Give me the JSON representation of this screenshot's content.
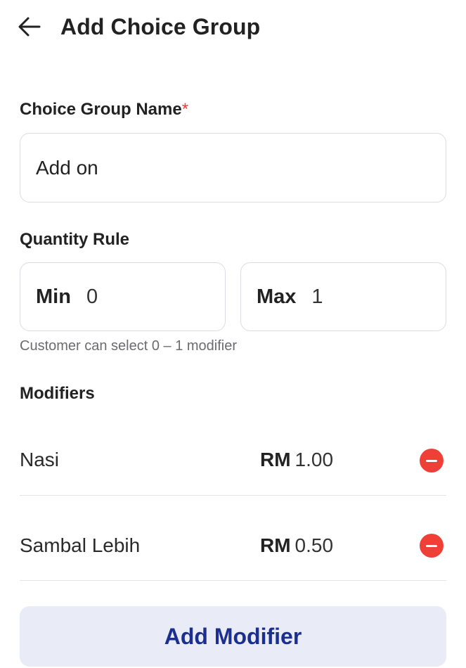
{
  "header": {
    "title": "Add Choice Group",
    "back_icon": "arrow-left-icon"
  },
  "name_field": {
    "label": "Choice Group Name",
    "required_mark": "*",
    "value": "Add on"
  },
  "quantity_rule": {
    "label": "Quantity Rule",
    "min_label": "Min",
    "min_value": "0",
    "max_label": "Max",
    "max_value": "1",
    "helper": "Customer can select 0 – 1 modifier"
  },
  "modifiers": {
    "label": "Modifiers",
    "items": [
      {
        "name": "Nasi",
        "currency": "RM",
        "price": "1.00"
      },
      {
        "name": "Sambal Lebih",
        "currency": "RM",
        "price": "0.50"
      }
    ]
  },
  "add_button": {
    "label": "Add Modifier"
  },
  "colors": {
    "accent": "#1c2f8f",
    "remove": "#ee4037",
    "required": "#e0453c",
    "button_bg": "#e9ebf6"
  }
}
